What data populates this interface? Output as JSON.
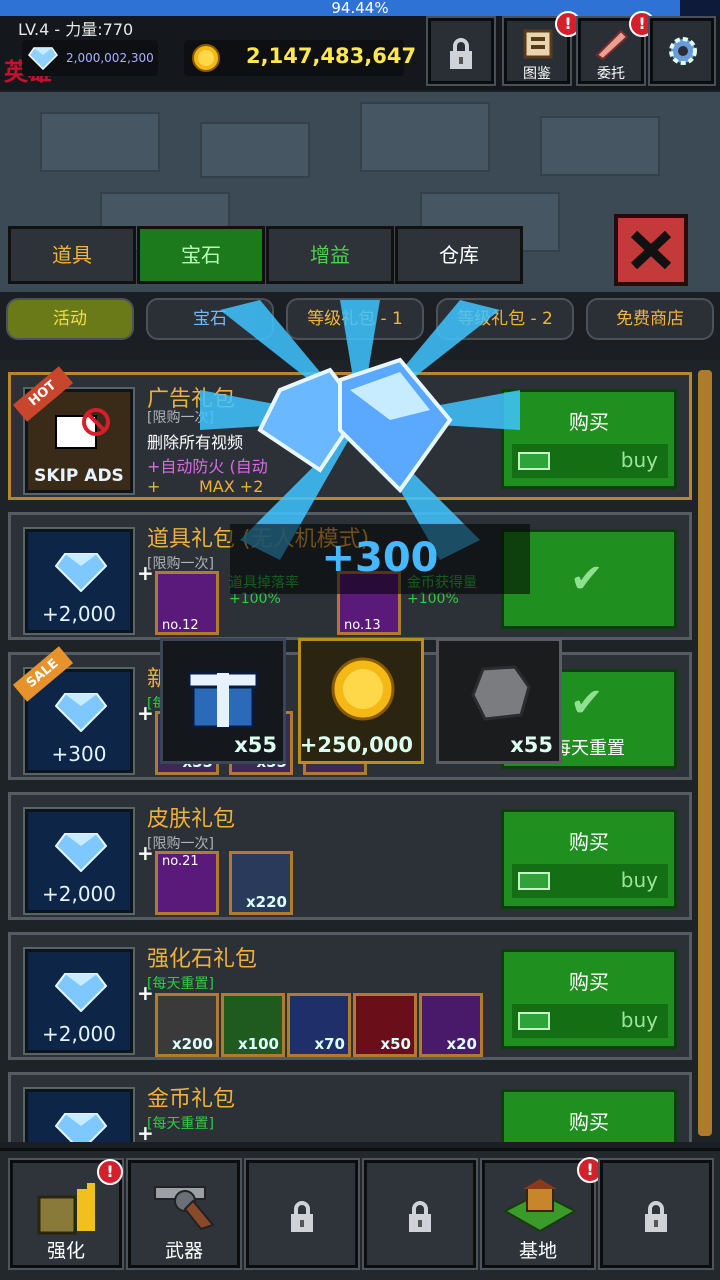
{
  "status": {
    "progress_text": "94.44%",
    "progress_fraction": 0.9444
  },
  "player": {
    "level_power": "LV.4 - 力量:770",
    "logo_text": "英雄",
    "gems": "2,000,002,300",
    "coins": "2,147,483,647"
  },
  "top_buttons": [
    {
      "name": "lock",
      "label": "",
      "icon": "lock-icon"
    },
    {
      "name": "collection",
      "label": "图鉴",
      "icon": "book-icon",
      "badge": "!"
    },
    {
      "name": "commission",
      "label": "委托",
      "icon": "scroll-icon",
      "badge": "!"
    },
    {
      "name": "settings",
      "label": "",
      "icon": "gear-icon"
    }
  ],
  "tabs": [
    {
      "label": "道具"
    },
    {
      "label": "宝石",
      "active": true
    },
    {
      "label": "增益"
    },
    {
      "label": "仓库"
    }
  ],
  "subtabs": [
    {
      "label": "活动",
      "active": true
    },
    {
      "label": "宝石"
    },
    {
      "label": "等级礼包 - 1"
    },
    {
      "label": "等级礼包 - 2"
    },
    {
      "label": "免费商店"
    }
  ],
  "packs": [
    {
      "title": "广告礼包",
      "limit": "[限购一次]",
      "desc1": "删除所有视频",
      "desc2": "+自动防火 (自动",
      "desc3_prefix": "+",
      "desc3": "MAX +2",
      "ribbon": "HOT",
      "tile_text": "SKIP ADS",
      "button": "购买",
      "price": "buy"
    },
    {
      "title": "道具礼包 (无人机模式)",
      "limit": "[限购一次]",
      "gem_amount": "+2,000",
      "items": [
        {
          "no": "no.12",
          "bonus": "道具掉落率\n+100%"
        },
        {
          "no": "no.13",
          "bonus": "金币获得量\n+100%"
        }
      ],
      "purchased": true
    },
    {
      "title": "新",
      "limit": "[每",
      "ribbon": "SALE",
      "gem_amount": "+300",
      "items": [
        {
          "count": "x55"
        },
        {
          "count": "x55"
        },
        {
          "count": ""
        }
      ],
      "reset_text": "每天重置",
      "purchased": true
    },
    {
      "title": "皮肤礼包",
      "limit": "[限购一次]",
      "gem_amount": "+2,000",
      "items": [
        {
          "no": "no.21",
          "count": ""
        },
        {
          "count": "x220"
        }
      ],
      "button": "购买",
      "price": "buy"
    },
    {
      "title": "强化石礼包",
      "limit": "[每天重置]",
      "gem_amount": "+2,000",
      "items": [
        {
          "count": "x200",
          "color": "#5a5a5a"
        },
        {
          "count": "x100",
          "color": "#2c8a2c"
        },
        {
          "count": "x70",
          "color": "#2c4a9a"
        },
        {
          "count": "x50",
          "color": "#a01c2c"
        },
        {
          "count": "x20",
          "color": "#6a2c9a"
        }
      ],
      "button": "购买",
      "price": "buy"
    },
    {
      "title": "金币礼包",
      "limit": "[每天重置]",
      "gem_amount": "",
      "button": "购买"
    }
  ],
  "reward_popup": {
    "amount": "+300",
    "rewards": [
      {
        "count": "x55",
        "icon": "gift-box-icon"
      },
      {
        "count": "+250,000",
        "icon": "gold-coin-icon"
      },
      {
        "count": "x55",
        "icon": "stone-icon"
      }
    ]
  },
  "bottom_nav": [
    {
      "label": "强化",
      "icon": "upgrade-icon",
      "badge": "!"
    },
    {
      "label": "武器",
      "icon": "revolver-icon"
    },
    {
      "label": "",
      "icon": "lock-icon"
    },
    {
      "label": "",
      "icon": "lock-icon"
    },
    {
      "label": "基地",
      "icon": "base-icon",
      "badge": "!"
    },
    {
      "label": "",
      "icon": "lock-icon"
    }
  ],
  "colors": {
    "accent_gold": "#f0b03a",
    "buy_green": "#1f8f1f",
    "gem_blue": "#46b8ff"
  }
}
